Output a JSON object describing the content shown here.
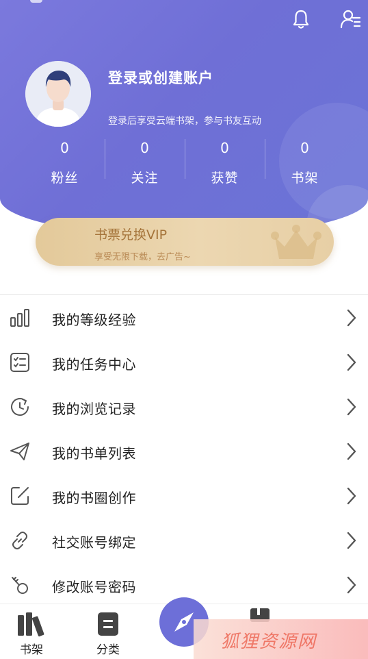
{
  "header": {
    "login_title": "登录或创建账户",
    "login_subtitle": "登录后享受云端书架，参与书友互动",
    "icons": [
      "bell-icon",
      "user-menu-icon"
    ],
    "stats": [
      {
        "value": "0",
        "label": "粉丝"
      },
      {
        "value": "0",
        "label": "关注"
      },
      {
        "value": "0",
        "label": "获赞"
      },
      {
        "value": "0",
        "label": "书架"
      }
    ]
  },
  "vip": {
    "title": "书票兑换VIP",
    "subtitle": "享受无限下载，去广告~"
  },
  "menu": [
    {
      "label": "我的等级经验",
      "icon": "level-bars-icon"
    },
    {
      "label": "我的任务中心",
      "icon": "task-list-icon"
    },
    {
      "label": "我的浏览记录",
      "icon": "history-clock-icon"
    },
    {
      "label": "我的书单列表",
      "icon": "paper-plane-icon"
    },
    {
      "label": "我的书圈创作",
      "icon": "edit-note-icon"
    },
    {
      "label": "社交账号绑定",
      "icon": "link-icon"
    },
    {
      "label": "修改账号密码",
      "icon": "key-icon"
    }
  ],
  "bottom_nav": [
    {
      "label": "书架",
      "icon": "bookshelf-icon"
    },
    {
      "label": "分类",
      "icon": "category-icon"
    },
    {
      "label": "",
      "icon": "compass-icon"
    }
  ],
  "watermark": "狐狸资源网",
  "colors": {
    "header_bg": "#7075d9",
    "vip_gold": "#e6cc9f",
    "vip_text": "#a5743a",
    "accent": "#6d6fd8"
  }
}
